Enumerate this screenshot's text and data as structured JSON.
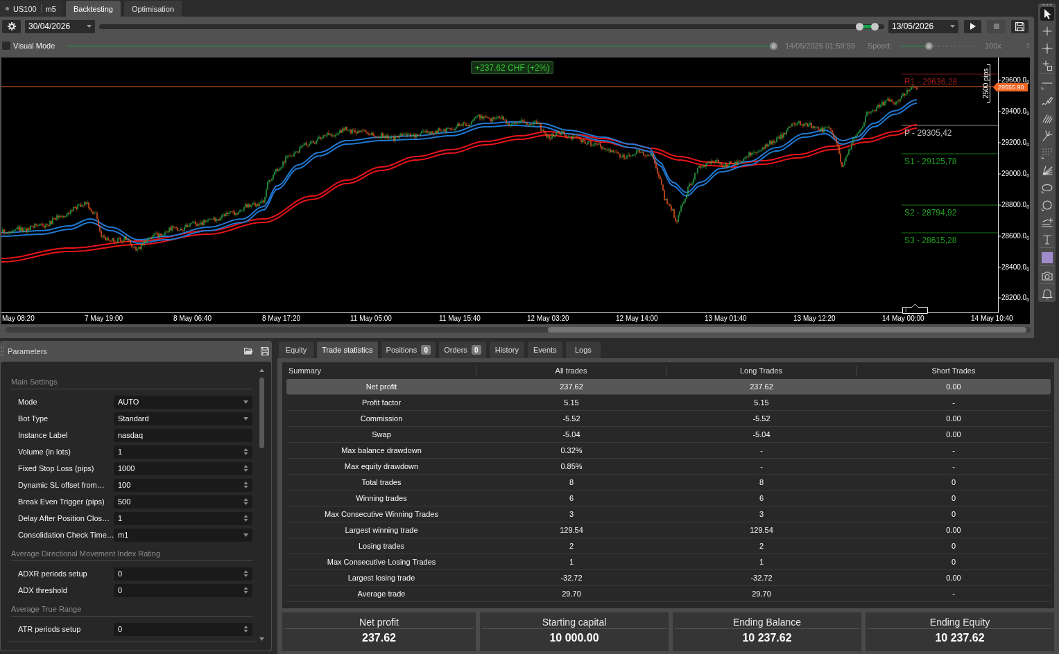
{
  "symbol": {
    "name": "US100",
    "timeframe": "m5"
  },
  "tabs": [
    {
      "label": "Backtesting",
      "selected": true
    },
    {
      "label": "Optimisation",
      "selected": false
    }
  ],
  "backtest_controls": {
    "start_date": "30/04/2026",
    "period_slider": {
      "thumbs": [
        {
          "level": 0.969
        },
        {
          "level": 0.988
        }
      ]
    },
    "end_date": "13/05/2026",
    "buttons": [
      {
        "kind": "play",
        "disabled": false
      },
      {
        "kind": "stop",
        "disabled": true
      },
      {
        "kind": "save",
        "disabled": false
      }
    ]
  },
  "visual_mode": {
    "label": "Visual Mode",
    "checked": false
  },
  "playback": {
    "disabled": true,
    "progress": {
      "level": 1
    },
    "time": "14/05/2026 01:59:59",
    "speed_label": "Speed:",
    "speed": {
      "level": 0.39
    },
    "speed_value": "100x"
  },
  "chart": {
    "profit_badge": "+237.62 CHF (+2%)",
    "pivots": [
      {
        "label": "R1 - 29636,28",
        "color": "#9b1c1c"
      },
      {
        "label": "P - 29305,42",
        "color": "#bdbdbd"
      },
      {
        "label": "S1 - 29125,78",
        "color": "#22a022"
      },
      {
        "label": "S2 - 28794,92",
        "color": "#22a022"
      },
      {
        "label": "S3 - 28615,28",
        "color": "#22a022"
      }
    ],
    "current_price": "29555.90",
    "ruler": "2500 pips",
    "y_axis": [
      "29600.0$_{0}$",
      "29400.0$_{0}$",
      "29200.0$_{0}$",
      "29000.0$_{0}$",
      "28800.0$_{0}$",
      "28600.0$_{0}$",
      "28400.0$_{0}$",
      "28200.0$_{0}$"
    ],
    "x_axis": [
      "May 08:20",
      "7 May 19:00",
      "8 May 06:40",
      "8 May 17:20",
      "11 May 05:00",
      "11 May 15:40",
      "12 May 03:20",
      "12 May 14:00",
      "13 May 01:40",
      "13 May 12:20",
      "14 May 00:00",
      "14 May 10:40"
    ]
  },
  "drawing_tools": [
    {
      "selected": true
    },
    {
      "selected": false
    },
    {
      "selected": false
    },
    {
      "selected": false
    },
    {
      "selected": false
    },
    {
      "selected": false
    },
    {
      "selected": false
    },
    {
      "selected": false
    },
    {
      "selected": false
    },
    {
      "selected": false
    },
    {
      "selected": false
    },
    {
      "selected": false
    },
    {
      "selected": false
    },
    {
      "selected": false
    },
    {
      "selected": false,
      "color": "#a08ccc"
    },
    {
      "selected": false
    },
    {
      "selected": false
    }
  ],
  "parameters": {
    "title": "Parameters",
    "groups": [
      {
        "title": "Main Settings",
        "rows": [
          {
            "label": "Mode",
            "kind": "select",
            "value": "AUTO"
          },
          {
            "label": "Bot Type",
            "kind": "select",
            "value": "Standard"
          },
          {
            "label": "Instance Label",
            "kind": "text",
            "value": "nasdaq"
          },
          {
            "label": "Volume (in lots)",
            "kind": "number",
            "value": "1"
          },
          {
            "label": "Fixed Stop Loss (pips)",
            "kind": "number",
            "value": "1000"
          },
          {
            "label": "Dynamic SL offset from…",
            "kind": "number",
            "value": "100"
          },
          {
            "label": "Break Even Trigger (pips)",
            "kind": "number",
            "value": "500"
          },
          {
            "label": "Delay After Position Clos…",
            "kind": "number",
            "value": "1"
          },
          {
            "label": "Consolidation Check Time…",
            "kind": "select",
            "value": "m1"
          }
        ]
      },
      {
        "title": "Average Directional Movement Index Rating",
        "rows": [
          {
            "label": "ADXR periods setup",
            "kind": "number",
            "value": "0"
          },
          {
            "label": "ADX threshold",
            "kind": "number",
            "value": "0"
          }
        ]
      },
      {
        "title": "Average True Range",
        "rows": [
          {
            "label": "ATR periods setup",
            "kind": "number",
            "value": "0"
          }
        ]
      }
    ]
  },
  "results_tabs": [
    {
      "label": "Equity",
      "selected": false
    },
    {
      "label": "Trade statistics",
      "selected": true
    },
    {
      "label": "Positions",
      "badge": "0",
      "selected": false
    },
    {
      "label": "Orders",
      "badge": "0",
      "selected": false
    },
    {
      "label": "History",
      "selected": false
    },
    {
      "label": "Events",
      "selected": false
    },
    {
      "label": "Logs",
      "selected": false
    }
  ],
  "statistics": {
    "columns": [
      "Summary",
      "All trades",
      "Long Trades",
      "Short Trades"
    ],
    "rows": [
      {
        "cells": [
          "Net profit",
          "237.62",
          "237.62",
          "0.00"
        ],
        "selected": true
      },
      {
        "cells": [
          "Profit factor",
          "5.15",
          "5.15",
          "-"
        ],
        "selected": false
      },
      {
        "cells": [
          "Commission",
          "-5.52",
          "-5.52",
          "0.00"
        ],
        "selected": false
      },
      {
        "cells": [
          "Swap",
          "-5.04",
          "-5.04",
          "0.00"
        ],
        "selected": false
      },
      {
        "cells": [
          "Max balance drawdown",
          "0.32%",
          "-",
          "-"
        ],
        "selected": false
      },
      {
        "cells": [
          "Max equity drawdown",
          "0.85%",
          "-",
          "-"
        ],
        "selected": false
      },
      {
        "cells": [
          "Total trades",
          "8",
          "8",
          "0"
        ],
        "selected": false
      },
      {
        "cells": [
          "Winning trades",
          "6",
          "6",
          "0"
        ],
        "selected": false
      },
      {
        "cells": [
          "Max Consecutive Winning Trades",
          "3",
          "3",
          "0"
        ],
        "selected": false
      },
      {
        "cells": [
          "Largest winning trade",
          "129.54",
          "129.54",
          "0.00"
        ],
        "selected": false
      },
      {
        "cells": [
          "Losing trades",
          "2",
          "2",
          "0"
        ],
        "selected": false
      },
      {
        "cells": [
          "Max Consecutive Losing Trades",
          "1",
          "1",
          "0"
        ],
        "selected": false
      },
      {
        "cells": [
          "Largest losing trade",
          "-32.72",
          "-32.72",
          "0.00"
        ],
        "selected": false
      },
      {
        "cells": [
          "Average trade",
          "29.70",
          "29.70",
          "-"
        ],
        "selected": false
      }
    ]
  },
  "summary_cards": [
    {
      "label": "Net profit",
      "value": "237.62"
    },
    {
      "label": "Starting capital",
      "value": "10 000.00"
    },
    {
      "label": "Ending Balance",
      "value": "10 237.62"
    },
    {
      "label": "Ending Equity",
      "value": "10 237.62"
    }
  ]
}
